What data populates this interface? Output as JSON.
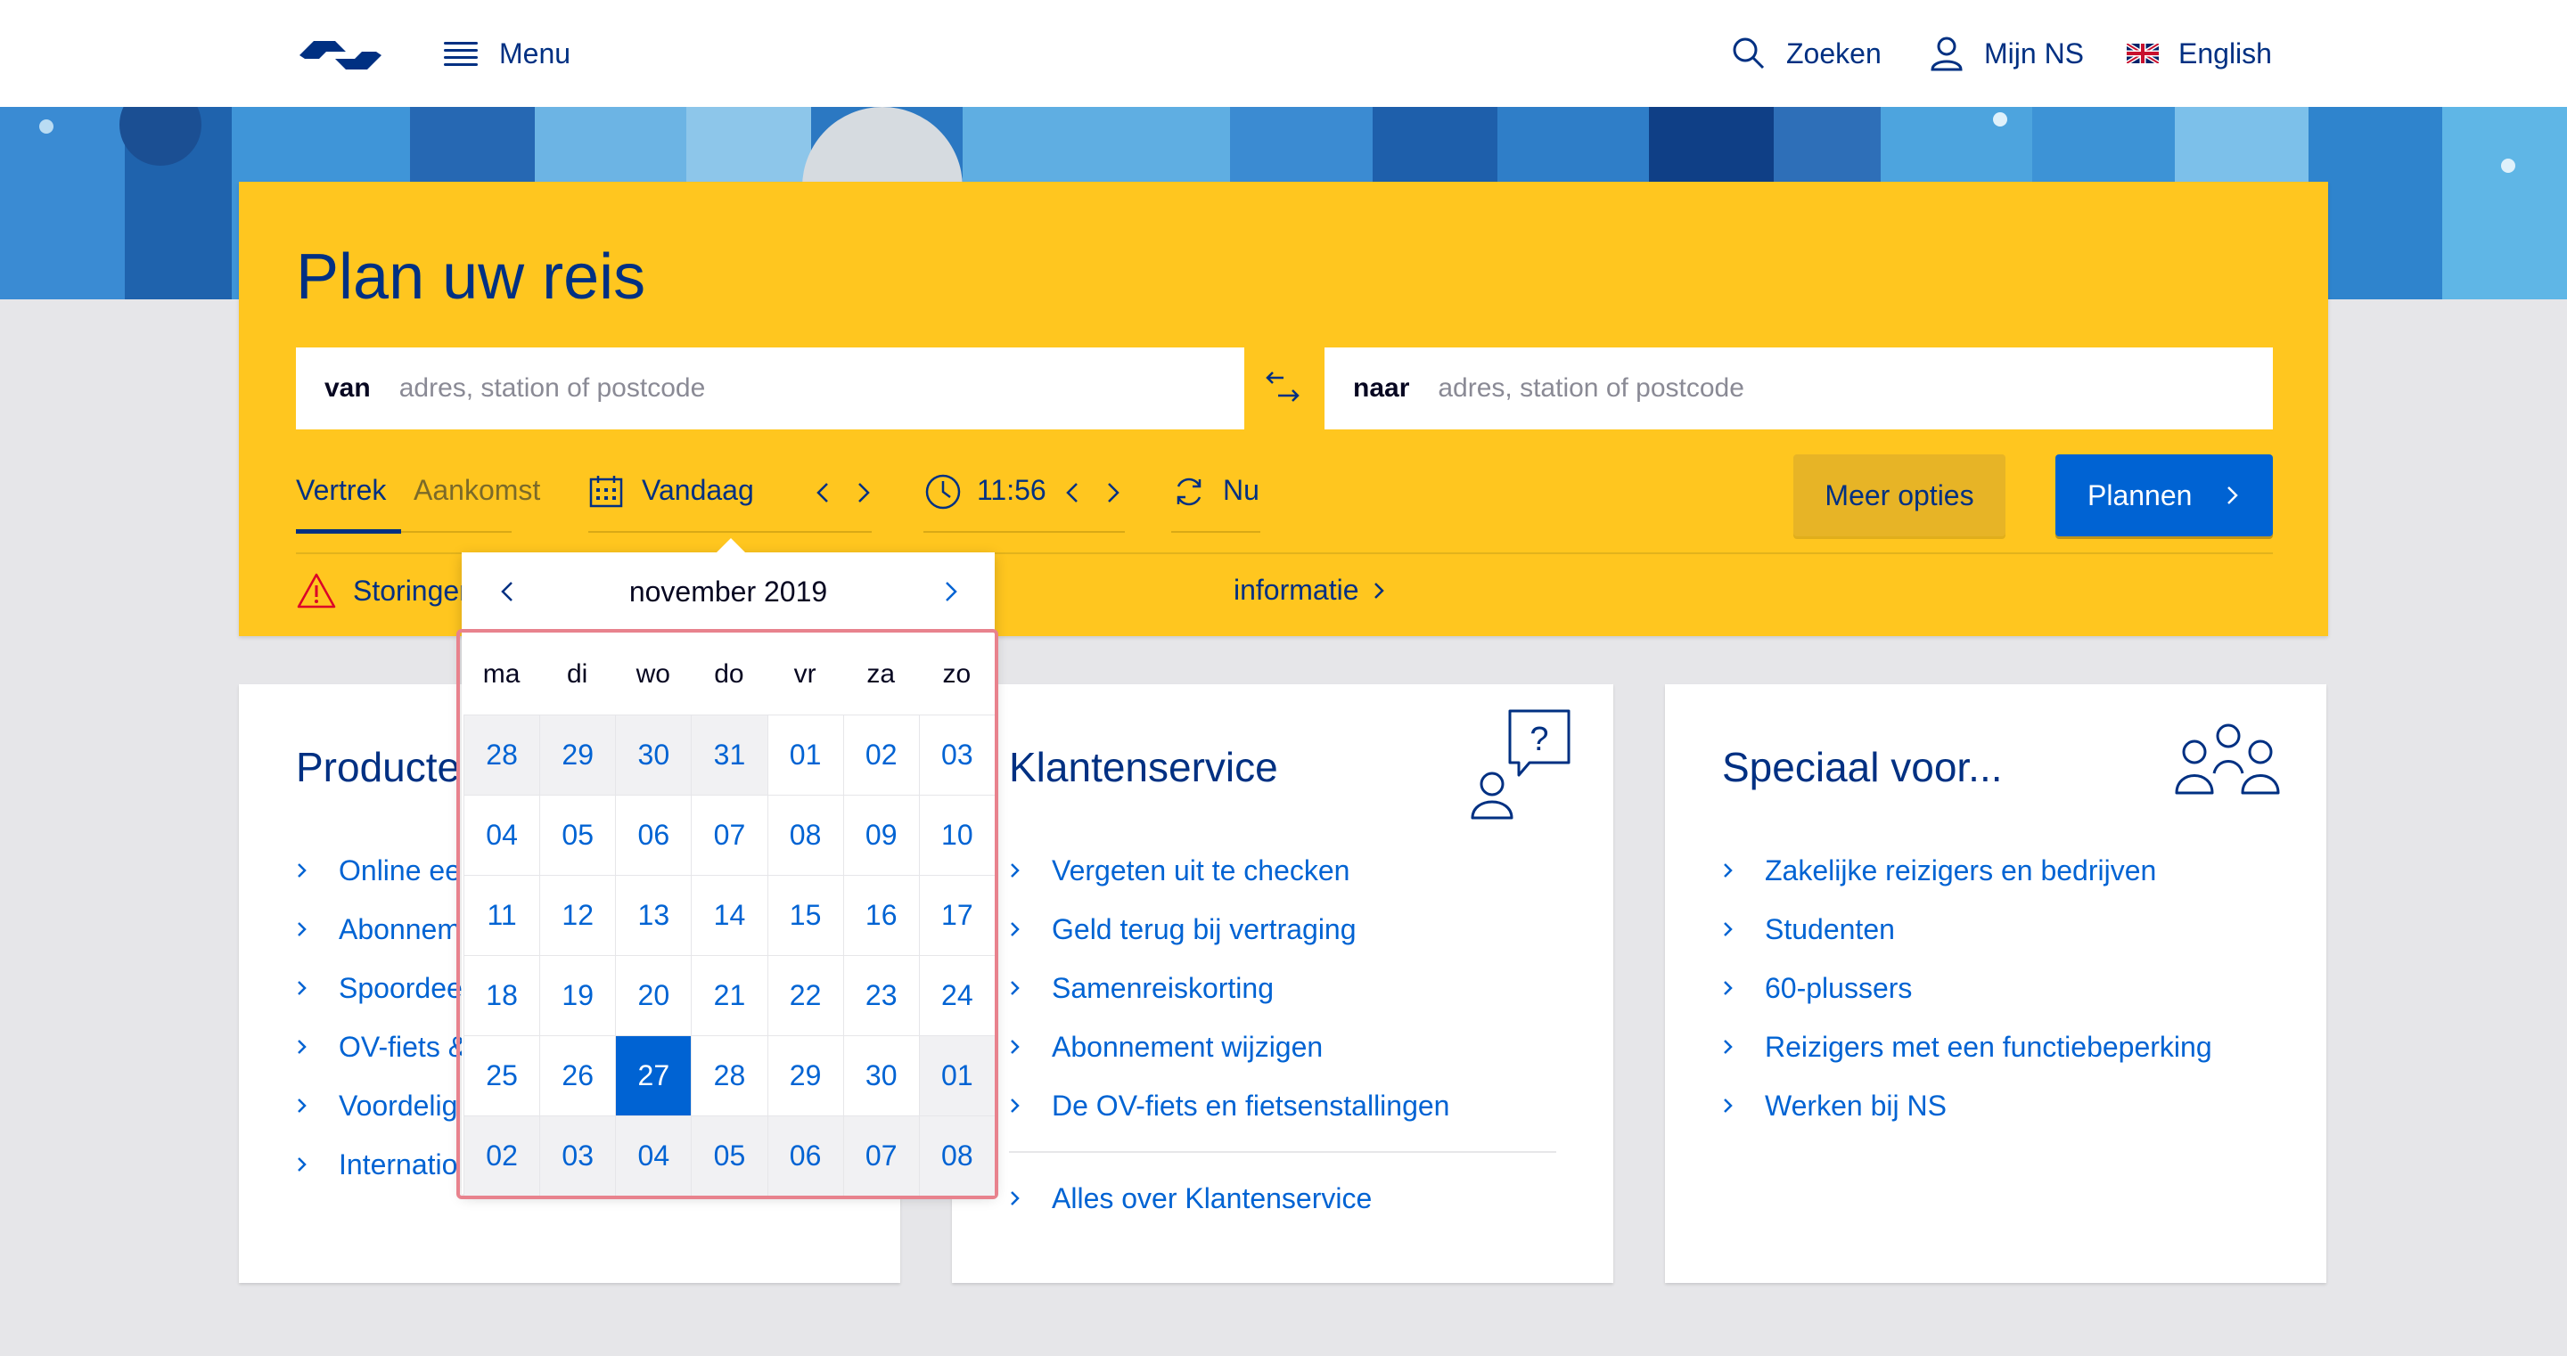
{
  "header": {
    "logo_name": "NS",
    "menu_label": "Menu",
    "search_label": "Zoeken",
    "account_label": "Mijn NS",
    "language_label": "English"
  },
  "planner": {
    "title": "Plan uw reis",
    "from_label": "van",
    "from_placeholder": "adres, station of postcode",
    "to_label": "naar",
    "to_placeholder": "adres, station of postcode",
    "tab_departure": "Vertrek",
    "tab_arrival": "Aankomst",
    "date_value": "Vandaag",
    "time_value": "11:56",
    "now_label": "Nu",
    "more_options_label": "Meer opties",
    "plan_button_label": "Plannen",
    "disruptions_label": "Storingen",
    "info_link_label": "informatie"
  },
  "datepicker": {
    "month_label": "november 2019",
    "weekdays": [
      "ma",
      "di",
      "wo",
      "do",
      "vr",
      "za",
      "zo"
    ],
    "weeks": [
      [
        "28",
        "29",
        "30",
        "31",
        "01",
        "02",
        "03"
      ],
      [
        "04",
        "05",
        "06",
        "07",
        "08",
        "09",
        "10"
      ],
      [
        "11",
        "12",
        "13",
        "14",
        "15",
        "16",
        "17"
      ],
      [
        "18",
        "19",
        "20",
        "21",
        "22",
        "23",
        "24"
      ],
      [
        "25",
        "26",
        "27",
        "28",
        "29",
        "30",
        "01"
      ],
      [
        "02",
        "03",
        "04",
        "05",
        "06",
        "07",
        "08"
      ]
    ],
    "selected_day": "27",
    "other_month_cells": [
      [
        0,
        0
      ],
      [
        0,
        1
      ],
      [
        0,
        2
      ],
      [
        0,
        3
      ],
      [
        4,
        6
      ],
      [
        5,
        0
      ],
      [
        5,
        1
      ],
      [
        5,
        2
      ],
      [
        5,
        3
      ],
      [
        5,
        4
      ],
      [
        5,
        5
      ],
      [
        5,
        6
      ]
    ]
  },
  "cards": {
    "products": {
      "title": "Producte",
      "items": [
        "Online ee",
        "Abonnem",
        "Spoordee",
        "OV-fiets &",
        "Voordelig",
        "Internatio"
      ]
    },
    "service": {
      "title": "Klantenservice",
      "items": [
        "Vergeten uit te checken",
        "Geld terug bij vertraging",
        "Samenreiskorting",
        "Abonnement wijzigen",
        "De OV-fiets en fietsenstallingen"
      ],
      "footer_link": "Alles over Klantenservice"
    },
    "special": {
      "title": "Speciaal voor...",
      "items": [
        "Zakelijke reizigers en bedrijven",
        "Studenten",
        "60-plussers",
        "Reizigers met een functiebeperking",
        "Werken bij NS"
      ]
    }
  },
  "colors": {
    "brand_yellow": "#ffc61f",
    "brand_blue": "#003082",
    "link_blue": "#0063d3",
    "page_gray": "#e6e6e9",
    "alert_red": "#db0029"
  }
}
